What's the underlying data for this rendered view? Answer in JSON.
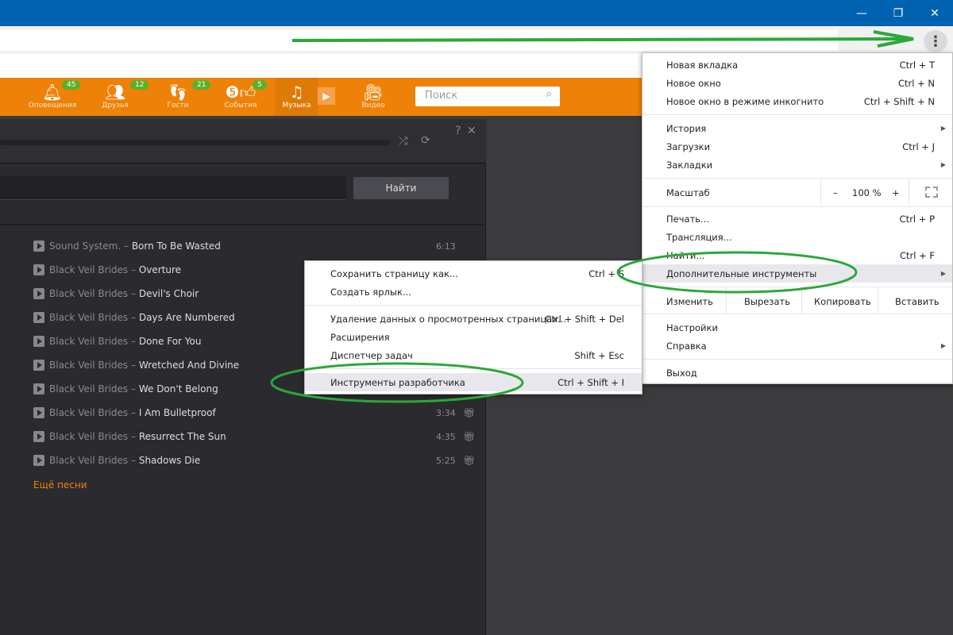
{
  "window": {
    "minimize": "—",
    "restore": "❐",
    "close": "✕"
  },
  "browser": {
    "menu_icon": "more-vert-icon",
    "menu_label": "⋮"
  },
  "nav": {
    "items": [
      {
        "label": "Оповещения",
        "badge": "45",
        "icon": "bell-icon"
      },
      {
        "label": "Друзья",
        "badge": "12",
        "icon": "friends-icon"
      },
      {
        "label": "Гости",
        "badge": "21",
        "icon": "footprints-icon"
      },
      {
        "label": "События",
        "badge": "5",
        "icon": "events-icon"
      },
      {
        "label": "Музыка",
        "icon": "music-icon"
      },
      {
        "label": "Видео",
        "icon": "video-icon"
      }
    ],
    "search_placeholder": "Поиск",
    "accent": "#ee8208"
  },
  "player": {
    "help": "?",
    "close": "✕",
    "find_button": "Найти",
    "songs": [
      {
        "artist": "Sound System.",
        "title": "Born To Be Wasted",
        "duration": "6:13"
      },
      {
        "artist": "Black Veil Brides",
        "title": "Overture"
      },
      {
        "artist": "Black Veil Brides",
        "title": "Devil's Choir"
      },
      {
        "artist": "Black Veil Brides",
        "title": "Days Are Numbered"
      },
      {
        "artist": "Black Veil Brides",
        "title": "Done For You"
      },
      {
        "artist": "Black Veil Brides",
        "title": "Wretched And Divine"
      },
      {
        "artist": "Black Veil Brides",
        "title": "We Don't Belong"
      },
      {
        "artist": "Black Veil Brides",
        "title": "I Am Bulletproof",
        "duration": "3:34",
        "gift": true
      },
      {
        "artist": "Black Veil Brides",
        "title": "Resurrect The Sun",
        "duration": "4:35",
        "gift": true
      },
      {
        "artist": "Black Veil Brides",
        "title": "Shadows Die",
        "duration": "5:25",
        "gift": true
      }
    ],
    "more_songs": "Ещё песни"
  },
  "chrome_menu": {
    "new_tab": "Новая вкладка",
    "new_tab_sc": "Ctrl + T",
    "new_window": "Новое окно",
    "new_window_sc": "Ctrl + N",
    "incognito": "Новое окно в режиме инкогнито",
    "incognito_sc": "Ctrl + Shift + N",
    "history": "История",
    "downloads": "Загрузки",
    "downloads_sc": "Ctrl + J",
    "bookmarks": "Закладки",
    "zoom": "Масштаб",
    "zoom_minus": "–",
    "zoom_value": "100 %",
    "zoom_plus": "+",
    "print": "Печать...",
    "print_sc": "Ctrl + P",
    "cast": "Трансляция...",
    "find": "Найти...",
    "find_sc": "Ctrl + F",
    "more_tools": "Дополнительные инструменты",
    "edit": "Изменить",
    "cut": "Вырезать",
    "copy": "Копировать",
    "paste": "Вставить",
    "settings": "Настройки",
    "help": "Справка",
    "exit": "Выход"
  },
  "submenu": {
    "save_page": "Сохранить страницу как...",
    "save_page_sc": "Ctrl + S",
    "create_shortcut": "Создать ярлык...",
    "clear_data": "Удаление данных о просмотренных страницах...",
    "clear_data_sc": "Ctrl + Shift + Del",
    "extensions": "Расширения",
    "task_manager": "Диспетчер задач",
    "task_manager_sc": "Shift + Esc",
    "devtools": "Инструменты разработчика",
    "devtools_sc": "Ctrl + Shift + I"
  },
  "annotation_color": "#2aa83a"
}
